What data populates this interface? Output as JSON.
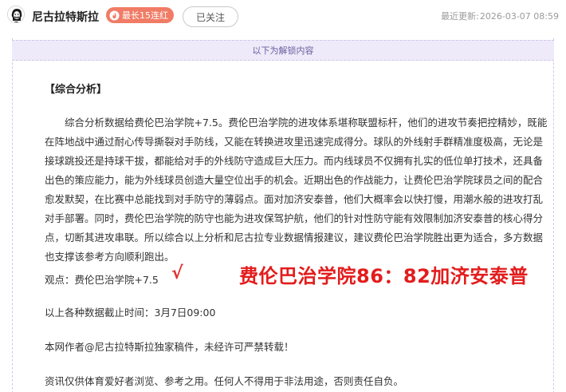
{
  "header": {
    "author_name": "尼古拉特斯拉",
    "streak_badge": "最长15连红",
    "follow_button": "已关注",
    "updated_label": "最近更新:",
    "updated_time": "2026-03-07 08:59",
    "badge_color": "#f07c66"
  },
  "unlock_bar": {
    "label": "以下为解锁内容"
  },
  "article": {
    "section_title": "【综合分析】",
    "analysis": "综合分析数据给费伦巴治学院+7.5。费伦巴治学院的进攻体系堪称联盟标杆，他们的进攻节奏把控精妙，既能在阵地战中通过耐心传导撕裂对手防线，又能在转换进攻里迅速完成得分。球队的外线射手群精准度极高，无论是接球跳投还是持球干拔，都能给对手的外线防守造成巨大压力。而内线球员不仅拥有扎实的低位单打技术，还具备出色的策应能力，能为外线球员创造大量空位出手的机会。近期出色的作战能力，让费伦巴治学院球员之间的配合愈发默契，在比赛中总能找到对手防守的薄弱点。面对加济安泰普，他们大概率会以快打慢，用潮水般的进攻打乱对手部署。同时，费伦巴治学院的防守也能为进攻保驾护航，他们的针对性防守能有效限制加济安泰普的核心得分点，切断其进攻串联。所以综合以上分析和尼古拉专业数据情报建议，建议费伦巴治学院胜出更为适合，多方数据也支撑该参考方向顺利跑出。",
    "viewpoint": "观点：费伦巴治学院+7.5",
    "check_mark": "√",
    "score_result": "费伦巴治学院86：82加济安泰普",
    "cutoff": "以上各种数据截止时间：3月7日09:00",
    "copyright": "本网作者@尼古拉特斯拉独家稿件，未经许可严禁转载！",
    "disclaimer": "资讯仅供体育爱好者浏览、参考之用。任何人不得用于非法用途，否则责任自负。",
    "highlight_color": "#e31c1c"
  }
}
